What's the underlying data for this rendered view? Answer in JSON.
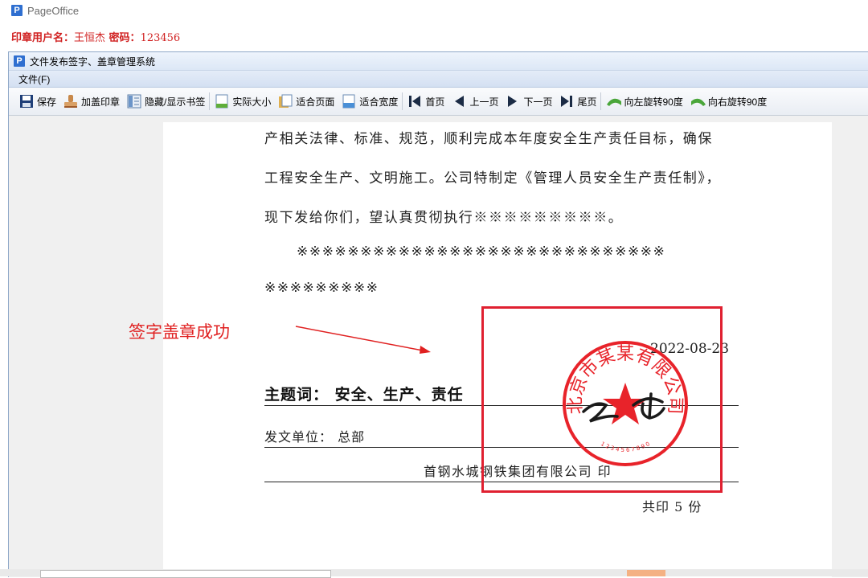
{
  "browser": {
    "title": "PageOffice"
  },
  "login": {
    "label": "印章用户名：",
    "username": "王恒杰",
    "password_label": " 密码：",
    "password": "123456"
  },
  "window": {
    "logo": "P",
    "title": "文件发布签字、盖章管理系统"
  },
  "menu": {
    "file": "文件(F)"
  },
  "toolbar": {
    "items": [
      {
        "label": "保存",
        "icon": "save-icon"
      },
      {
        "label": "加盖印章",
        "icon": "stamp-icon"
      },
      {
        "label": "隐藏/显示书签",
        "icon": "bookmark-icon"
      },
      {
        "label": "实际大小",
        "icon": "actual-size-icon"
      },
      {
        "label": "适合页面",
        "icon": "fit-page-icon"
      },
      {
        "label": "适合宽度",
        "icon": "fit-width-icon"
      },
      {
        "label": "首页",
        "icon": "first-page-icon"
      },
      {
        "label": "上一页",
        "icon": "prev-page-icon"
      },
      {
        "label": "下一页",
        "icon": "next-page-icon"
      },
      {
        "label": "尾页",
        "icon": "last-page-icon"
      },
      {
        "label": "向左旋转90度",
        "icon": "rotate-left-icon"
      },
      {
        "label": "向右旋转90度",
        "icon": "rotate-right-icon"
      }
    ]
  },
  "document": {
    "lines": [
      "产相关法律、标准、规范，顺利完成本年度安全生产责任目标，确保",
      "工程安全生产、文明施工。公司特制定《管理人员安全生产责任制》，",
      "现下发给你们，望认真贯彻执行※※※※※※※※※。",
      "※※※※※※※※※※※※※※※※※※※※※※※※※※※※※",
      "※※※※※※※※※"
    ],
    "date": "2022-08-23",
    "subject": "主题词：  安全、生产、责任",
    "issuer": "发文单位：  总部",
    "printer": "首钢水城钢铁集团有限公司   印",
    "copies": "共印 5 份"
  },
  "seal": {
    "text": "北京市某某有限公司",
    "digits": "1 2 3 4 5 6 7 8 9 0",
    "signature": "王五",
    "color": "#e8232a"
  },
  "annotation": {
    "text": "签字盖章成功",
    "color": "#e02020"
  }
}
